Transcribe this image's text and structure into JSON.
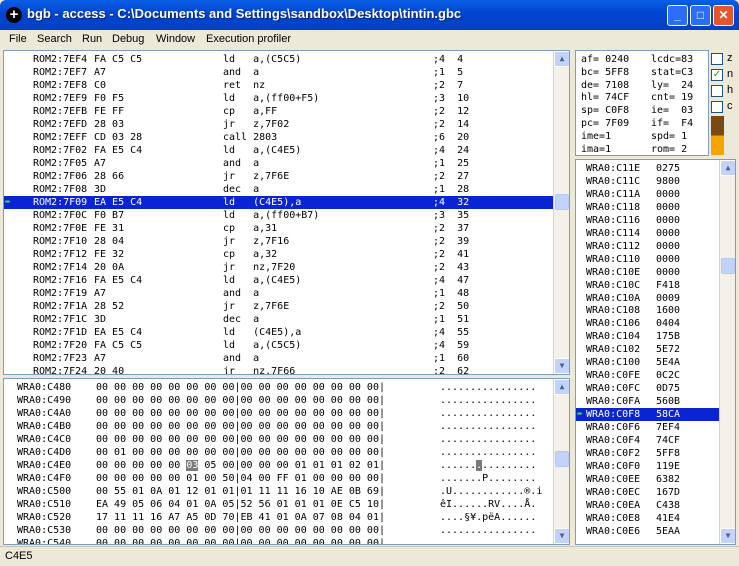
{
  "window": {
    "title": "bgb - access - C:\\Documents and Settings\\sandbox\\Desktop\\tintin.gbc",
    "icon": "crosshair-icon"
  },
  "menu": [
    "File",
    "Search",
    "Run",
    "Debug",
    "Window",
    "Execution profiler"
  ],
  "disasm": [
    {
      "addr": "ROM2:7EF4",
      "bytes": "FA C5 C5",
      "instr": "ld   a,(C5C5)",
      "cmt": ";4  4"
    },
    {
      "addr": "ROM2:7EF7",
      "bytes": "A7",
      "instr": "and  a",
      "cmt": ";1  5"
    },
    {
      "addr": "ROM2:7EF8",
      "bytes": "C0",
      "instr": "ret  nz",
      "cmt": ";2  7"
    },
    {
      "addr": "ROM2:7EF9",
      "bytes": "F0 F5",
      "instr": "ld   a,(ff00+F5)",
      "cmt": ";3  10"
    },
    {
      "addr": "ROM2:7EFB",
      "bytes": "FE FF",
      "instr": "cp   a,FF",
      "cmt": ";2  12"
    },
    {
      "addr": "ROM2:7EFD",
      "bytes": "28 03",
      "instr": "jr   z,7F02",
      "cmt": ";2  14"
    },
    {
      "addr": "ROM2:7EFF",
      "bytes": "CD 03 28",
      "instr": "call 2803",
      "cmt": ";6  20"
    },
    {
      "addr": "ROM2:7F02",
      "bytes": "FA E5 C4",
      "instr": "ld   a,(C4E5)",
      "cmt": ";4  24"
    },
    {
      "addr": "ROM2:7F05",
      "bytes": "A7",
      "instr": "and  a",
      "cmt": ";1  25"
    },
    {
      "addr": "ROM2:7F06",
      "bytes": "28 66",
      "instr": "jr   z,7F6E",
      "cmt": ";2  27"
    },
    {
      "addr": "ROM2:7F08",
      "bytes": "3D",
      "instr": "dec  a",
      "cmt": ";1  28"
    },
    {
      "addr": "ROM2:7F09",
      "bytes": "EA E5 C4",
      "instr": "ld   (C4E5),a",
      "cmt": ";4  32",
      "selected": true
    },
    {
      "addr": "ROM2:7F0C",
      "bytes": "F0 B7",
      "instr": "ld   a,(ff00+B7)",
      "cmt": ";3  35"
    },
    {
      "addr": "ROM2:7F0E",
      "bytes": "FE 31",
      "instr": "cp   a,31",
      "cmt": ";2  37"
    },
    {
      "addr": "ROM2:7F10",
      "bytes": "28 04",
      "instr": "jr   z,7F16",
      "cmt": ";2  39"
    },
    {
      "addr": "ROM2:7F12",
      "bytes": "FE 32",
      "instr": "cp   a,32",
      "cmt": ";2  41"
    },
    {
      "addr": "ROM2:7F14",
      "bytes": "20 0A",
      "instr": "jr   nz,7F20",
      "cmt": ";2  43"
    },
    {
      "addr": "ROM2:7F16",
      "bytes": "FA E5 C4",
      "instr": "ld   a,(C4E5)",
      "cmt": ";4  47"
    },
    {
      "addr": "ROM2:7F19",
      "bytes": "A7",
      "instr": "and  a",
      "cmt": ";1  48"
    },
    {
      "addr": "ROM2:7F1A",
      "bytes": "28 52",
      "instr": "jr   z,7F6E",
      "cmt": ";2  50"
    },
    {
      "addr": "ROM2:7F1C",
      "bytes": "3D",
      "instr": "dec  a",
      "cmt": ";1  51"
    },
    {
      "addr": "ROM2:7F1D",
      "bytes": "EA E5 C4",
      "instr": "ld   (C4E5),a",
      "cmt": ";4  55"
    },
    {
      "addr": "ROM2:7F20",
      "bytes": "FA C5 C5",
      "instr": "ld   a,(C5C5)",
      "cmt": ";4  59"
    },
    {
      "addr": "ROM2:7F23",
      "bytes": "A7",
      "instr": "and  a",
      "cmt": ";1  60"
    },
    {
      "addr": "ROM2:7F24",
      "bytes": "20 40",
      "instr": "jr   nz,7F66",
      "cmt": ";2  62"
    }
  ],
  "registers": [
    [
      "af= 0240",
      "lcdc=83"
    ],
    [
      "bc= 5FF8",
      "stat=C3"
    ],
    [
      "de= 7108",
      "ly=  24"
    ],
    [
      "hl= 74CF",
      "cnt= 19"
    ],
    [
      "sp= C0F8",
      "ie=  03"
    ],
    [
      "pc= 7F09",
      "if=  F4"
    ],
    [
      "ime=1",
      "spd= 1"
    ],
    [
      "ima=1",
      "rom= 2"
    ]
  ],
  "flags": [
    {
      "label": "z",
      "checked": false
    },
    {
      "label": "n",
      "checked": true
    },
    {
      "label": "h",
      "checked": false
    },
    {
      "label": "c",
      "checked": false
    }
  ],
  "stack": [
    [
      "WRA0:C11E",
      "0275"
    ],
    [
      "WRA0:C11C",
      "9800"
    ],
    [
      "WRA0:C11A",
      "0000"
    ],
    [
      "WRA0:C118",
      "0000"
    ],
    [
      "WRA0:C116",
      "0000"
    ],
    [
      "WRA0:C114",
      "0000"
    ],
    [
      "WRA0:C112",
      "0000"
    ],
    [
      "WRA0:C110",
      "0000"
    ],
    [
      "WRA0:C10E",
      "0000"
    ],
    [
      "WRA0:C10C",
      "F418"
    ],
    [
      "WRA0:C10A",
      "0009"
    ],
    [
      "WRA0:C108",
      "1600"
    ],
    [
      "WRA0:C106",
      "0404"
    ],
    [
      "WRA0:C104",
      "175B"
    ],
    [
      "WRA0:C102",
      "5E72"
    ],
    [
      "WRA0:C100",
      "5E4A"
    ],
    [
      "WRA0:C0FE",
      "0C2C"
    ],
    [
      "WRA0:C0FC",
      "0D75"
    ],
    [
      "WRA0:C0FA",
      "560B"
    ],
    [
      "WRA0:C0F8",
      "58CA"
    ],
    [
      "WRA0:C0F6",
      "7EF4"
    ],
    [
      "WRA0:C0F4",
      "74CF"
    ],
    [
      "WRA0:C0F2",
      "5FF8"
    ],
    [
      "WRA0:C0F0",
      "119E"
    ],
    [
      "WRA0:C0EE",
      "6382"
    ],
    [
      "WRA0:C0EC",
      "167D"
    ],
    [
      "WRA0:C0EA",
      "C438"
    ],
    [
      "WRA0:C0E8",
      "41E4"
    ],
    [
      "WRA0:C0E6",
      "5EAA"
    ]
  ],
  "stack_selected_index": 19,
  "memory": [
    {
      "addr": "WRA0:C480",
      "hex": "00 00 00 00 00 00 00 00|00 00 00 00 00 00 00 00|",
      "ascii": "................"
    },
    {
      "addr": "WRA0:C490",
      "hex": "00 00 00 00 00 00 00 00|00 00 00 00 00 00 00 00|",
      "ascii": "................"
    },
    {
      "addr": "WRA0:C4A0",
      "hex": "00 00 00 00 00 00 00 00|00 00 00 00 00 00 00 00|",
      "ascii": "................"
    },
    {
      "addr": "WRA0:C4B0",
      "hex": "00 00 00 00 00 00 00 00|00 00 00 00 00 00 00 00|",
      "ascii": "................"
    },
    {
      "addr": "WRA0:C4C0",
      "hex": "00 00 00 00 00 00 00 00|00 00 00 00 00 00 00 00|",
      "ascii": "................"
    },
    {
      "addr": "WRA0:C4D0",
      "hex": "00 01 00 00 00 00 00 00|00 00 00 00 00 00 00 00|",
      "ascii": "................"
    },
    {
      "addr": "WRA0:C4E0",
      "hex_a": "00 00 00 00 00 ",
      "hex_hl": "03",
      "hex_b": " 05 00|00 00 00 01 01 01 02 01|",
      "ascii_a": "......",
      "ascii_hl": ".",
      "ascii_b": ".........",
      "highlight": true
    },
    {
      "addr": "WRA0:C4F0",
      "hex": "00 00 00 00 00 01 00 50|04 00 FF 01 00 00 00 00|",
      "ascii": ".......P........"
    },
    {
      "addr": "WRA0:C500",
      "hex": "00 55 01 0A 01 12 01 01|01 11 11 16 10 AE 0B 69|",
      "ascii": ".U............®.i"
    },
    {
      "addr": "WRA0:C510",
      "hex": "EA 49 05 06 04 01 0A 05|52 56 01 01 01 0E C5 10|",
      "ascii": "êI......RV....Å."
    },
    {
      "addr": "WRA0:C520",
      "hex": "17 11 11 16 A7 A5 0D 70|EB 41 01 0A 07 08 04 01|",
      "ascii": "....§¥.pëA......"
    },
    {
      "addr": "WRA0:C530",
      "hex": "00 00 00 00 00 00 00 00|00 00 00 00 00 00 00 00|",
      "ascii": "................"
    },
    {
      "addr": "WRA0:C540",
      "hex": "00 00 00 00 00 00 00 00|00 00 00 00 00 00 00 00|",
      "ascii": "................"
    }
  ],
  "status": "C4E5"
}
